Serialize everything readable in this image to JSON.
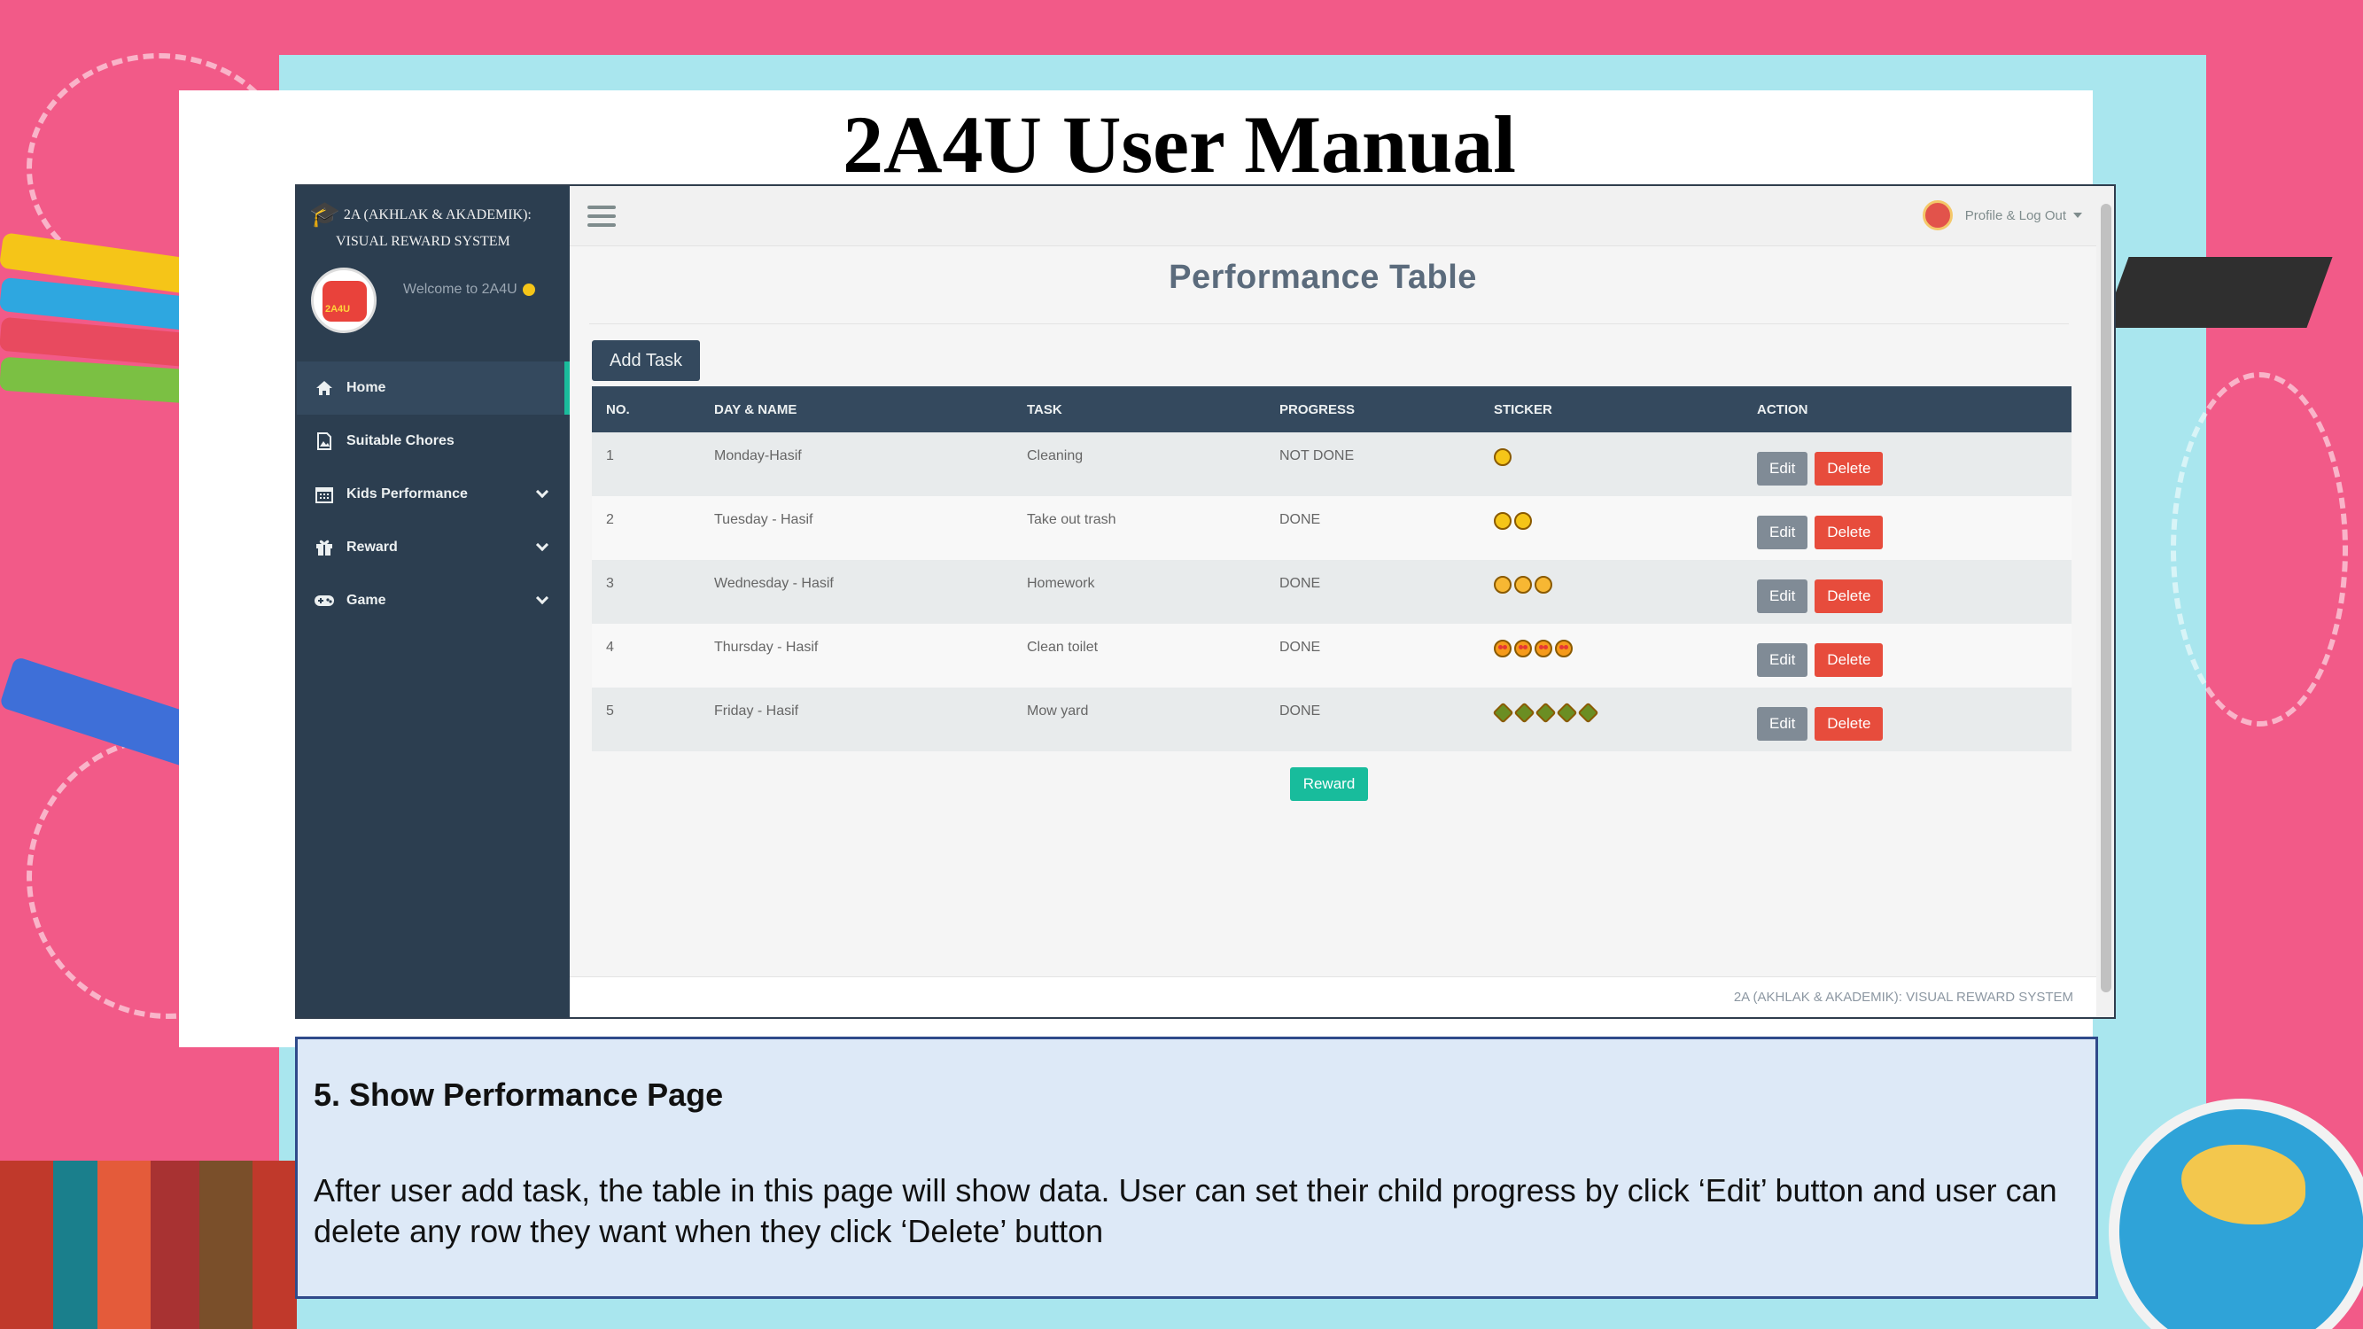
{
  "slide": {
    "title": "2A4U User Manual"
  },
  "app": {
    "brand_line1": "2A (AKHLAK & AKADEMIK):",
    "brand_line2": "VISUAL REWARD SYSTEM",
    "welcome": "Welcome to 2A4U",
    "profile_menu": "Profile & Log Out",
    "sidebar": {
      "items": [
        {
          "label": "Home",
          "icon": "home-icon",
          "active": true,
          "expandable": false
        },
        {
          "label": "Suitable Chores",
          "icon": "file-image-icon",
          "active": false,
          "expandable": false
        },
        {
          "label": "Kids Performance",
          "icon": "calendar-icon",
          "active": false,
          "expandable": true
        },
        {
          "label": "Reward",
          "icon": "gift-icon",
          "active": false,
          "expandable": true
        },
        {
          "label": "Game",
          "icon": "gamepad-icon",
          "active": false,
          "expandable": true
        }
      ]
    },
    "page_title": "Performance Table",
    "add_task_label": "Add Task",
    "table": {
      "headers": [
        "NO.",
        "DAY & NAME",
        "TASK",
        "PROGRESS",
        "STICKER",
        "ACTION"
      ],
      "rows": [
        {
          "no": "1",
          "day_name": "Monday-Hasif",
          "task": "Cleaning",
          "progress": "NOT DONE",
          "sticker": "sad-face",
          "sticker_count": 1
        },
        {
          "no": "2",
          "day_name": "Tuesday - Hasif",
          "task": "Take out trash",
          "progress": "DONE",
          "sticker": "smile-face",
          "sticker_count": 2
        },
        {
          "no": "3",
          "day_name": "Wednesday - Hasif",
          "task": "Homework",
          "progress": "DONE",
          "sticker": "grin-face",
          "sticker_count": 3
        },
        {
          "no": "4",
          "day_name": "Thursday - Hasif",
          "task": "Clean toilet",
          "progress": "DONE",
          "sticker": "heart-eyes-face",
          "sticker_count": 4
        },
        {
          "no": "5",
          "day_name": "Friday - Hasif",
          "task": "Mow yard",
          "progress": "DONE",
          "sticker": "star-face",
          "sticker_count": 5
        }
      ],
      "edit_label": "Edit",
      "delete_label": "Delete"
    },
    "reward_label": "Reward",
    "footer": "2A (AKHLAK & AKADEMIK): VISUAL REWARD SYSTEM"
  },
  "caption": {
    "heading": "5. Show Performance  Page",
    "body": "After user add task, the table in this page will show data. User can set their child progress by click ‘Edit’ button and user can delete any row they want when they click ‘Delete’ button"
  },
  "colors": {
    "sidebar": "#2c3e50",
    "header_bar": "#34495e",
    "accent_green": "#18bc9c",
    "delete_red": "#e74c3c",
    "edit_gray": "#808b96",
    "slide_pink": "#f25a88",
    "slide_cyan": "#a9e6ee",
    "caption_bg": "#dde9f7"
  }
}
